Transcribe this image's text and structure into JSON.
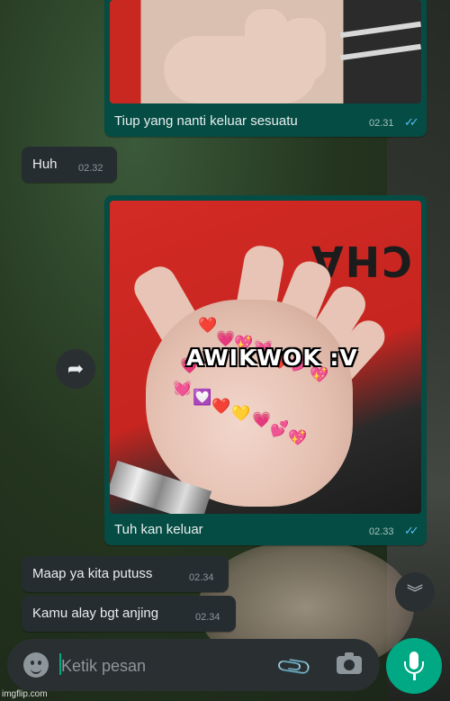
{
  "messages": [
    {
      "caption": "Tiup yang nanti keluar sesuatu",
      "time": "02.31"
    },
    {
      "text": "Huh",
      "time": "02.32"
    },
    {
      "caption": "Tuh kan keluar",
      "time": "02.33",
      "overlay": "AWIKWOK :V",
      "shirt_text": "CHA"
    },
    {
      "text": "Maap ya kita putuss",
      "time": "02.34"
    },
    {
      "text": "Kamu alay bgt anjing",
      "time": "02.34"
    }
  ],
  "composer": {
    "placeholder": "Ketik pesan"
  },
  "watermark": "imgflip.com",
  "icons": {
    "forward": "forward-arrow-icon",
    "scroll": "double-chevron-down-icon",
    "emoji": "emoji-icon",
    "attach": "paperclip-icon",
    "camera": "camera-icon",
    "mic": "microphone-icon",
    "read": "double-check-icon"
  },
  "colors": {
    "outgoing": "#054d44",
    "incoming": "#262d31",
    "accent": "#00a884",
    "read_ticks": "#53bdeb"
  }
}
